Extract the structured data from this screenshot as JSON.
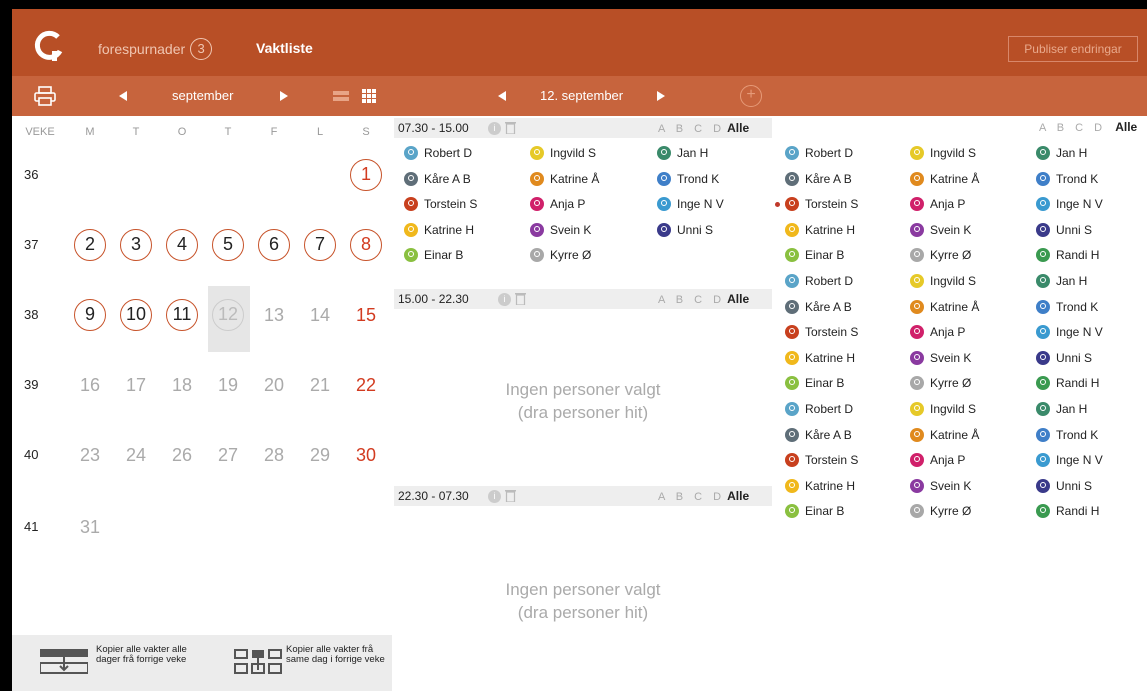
{
  "header": {
    "requests_label": "forespurnader",
    "requests_count": "3",
    "active_tab": "Vaktliste",
    "publish_label": "Publiser endringar"
  },
  "subbar": {
    "month": "september",
    "date": "12. september"
  },
  "calendar": {
    "week_label": "VEKE",
    "weekdays": [
      "M",
      "T",
      "O",
      "T",
      "F",
      "L",
      "S"
    ],
    "weeks": [
      {
        "num": "36",
        "days": [
          "",
          "",
          "",
          "",
          "",
          "",
          "1"
        ]
      },
      {
        "num": "37",
        "days": [
          "2",
          "3",
          "4",
          "5",
          "6",
          "7",
          "8"
        ]
      },
      {
        "num": "38",
        "days": [
          "9",
          "10",
          "11",
          "12",
          "13",
          "14",
          "15"
        ]
      },
      {
        "num": "39",
        "days": [
          "16",
          "17",
          "18",
          "19",
          "20",
          "21",
          "22"
        ]
      },
      {
        "num": "40",
        "days": [
          "23",
          "24",
          "26",
          "27",
          "28",
          "29",
          "30"
        ]
      },
      {
        "num": "41",
        "days": [
          "31",
          "",
          "",
          "",
          "",
          "",
          ""
        ]
      }
    ],
    "circled": [
      "1",
      "2",
      "3",
      "4",
      "5",
      "6",
      "7",
      "8",
      "9",
      "10",
      "11"
    ],
    "today": "12",
    "copy_week": "Kopier alle vakter alle dager frå forrige veke",
    "copy_day": "Kopier alle vakter frå same dag i forrige veke"
  },
  "shifts": [
    {
      "time": "07.30 - 15.00",
      "abcd": "A B C D",
      "alle": "Alle"
    },
    {
      "time": "15.00 - 22.30",
      "abcd": "A B C D",
      "alle": "Alle"
    },
    {
      "time": "22.30 - 07.30",
      "abcd": "A B C D",
      "alle": "Alle"
    }
  ],
  "right_filter": {
    "abcd": "A B C D",
    "alle": "Alle"
  },
  "empty_text": {
    "line1": "Ingen personer valgt",
    "line2": "(dra personer hit)"
  },
  "assigned": [
    {
      "name": "Robert D",
      "color": "#5aa4c8"
    },
    {
      "name": "Ingvild S",
      "color": "#e6c928"
    },
    {
      "name": "Jan H",
      "color": "#3a8a6a"
    },
    {
      "name": "Kåre A B",
      "color": "#5f6e78"
    },
    {
      "name": "Katrine Å",
      "color": "#e08a1e"
    },
    {
      "name": "Trond K",
      "color": "#3f7fc8"
    },
    {
      "name": "Torstein S",
      "color": "#c8401e"
    },
    {
      "name": "Anja P",
      "color": "#d0206a"
    },
    {
      "name": "Inge N V",
      "color": "#3a9ad0"
    },
    {
      "name": "Katrine H",
      "color": "#f0b81c"
    },
    {
      "name": "Svein K",
      "color": "#8a3aa0"
    },
    {
      "name": "Unni S",
      "color": "#3a3a8a"
    },
    {
      "name": "Einar B",
      "color": "#8ac040"
    },
    {
      "name": "Kyrre Ø",
      "color": "#a8a8a8"
    }
  ],
  "pool": [
    {
      "name": "Robert D",
      "color": "#5aa4c8"
    },
    {
      "name": "Ingvild S",
      "color": "#e6c928"
    },
    {
      "name": "Jan H",
      "color": "#3a8a6a"
    },
    {
      "name": "Kåre A B",
      "color": "#5f6e78"
    },
    {
      "name": "Katrine Å",
      "color": "#e08a1e"
    },
    {
      "name": "Trond K",
      "color": "#3f7fc8"
    },
    {
      "name": "Torstein S",
      "color": "#c8401e"
    },
    {
      "name": "Anja P",
      "color": "#d0206a"
    },
    {
      "name": "Inge N V",
      "color": "#3a9ad0"
    },
    {
      "name": "Katrine H",
      "color": "#f0b81c"
    },
    {
      "name": "Svein K",
      "color": "#8a3aa0"
    },
    {
      "name": "Unni S",
      "color": "#3a3a8a"
    },
    {
      "name": "Einar B",
      "color": "#8ac040"
    },
    {
      "name": "Kyrre Ø",
      "color": "#a8a8a8"
    },
    {
      "name": "Randi H",
      "color": "#3a9a50"
    }
  ],
  "pool_repeats": 3
}
